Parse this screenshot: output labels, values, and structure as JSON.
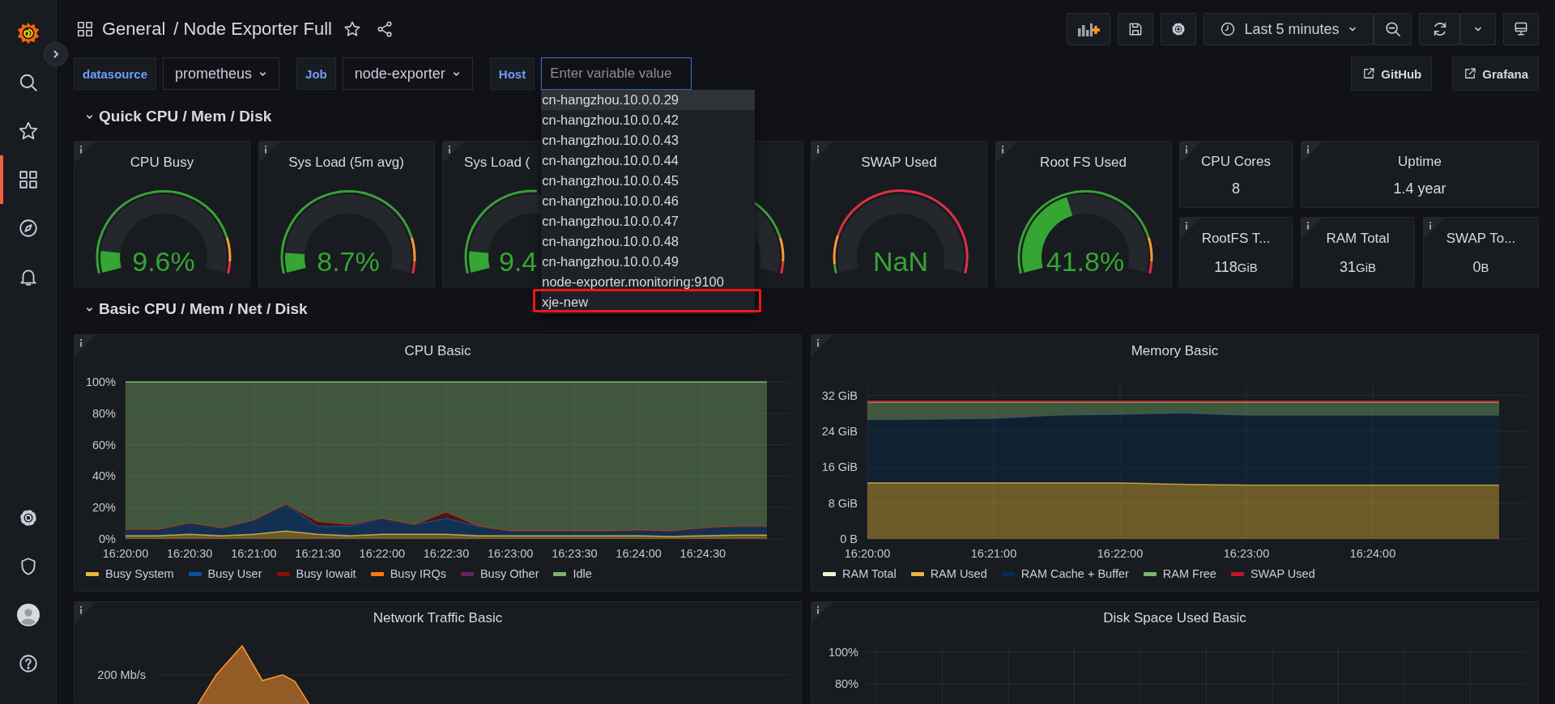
{
  "sidebar": {
    "items": [
      {
        "kind": "search",
        "selected": false
      },
      {
        "kind": "starred",
        "selected": false
      },
      {
        "kind": "dashboards",
        "selected": true
      },
      {
        "kind": "explore",
        "selected": false
      },
      {
        "kind": "alerting",
        "selected": false
      }
    ],
    "bottom_items": [
      {
        "kind": "settings",
        "selected": false
      },
      {
        "kind": "shield",
        "selected": false
      },
      {
        "kind": "profile",
        "selected": false
      },
      {
        "kind": "help",
        "selected": false
      }
    ]
  },
  "breadcrumb": {
    "folder": "General",
    "dashboard": "/ Node Exporter Full"
  },
  "toolbar": {
    "time_range": "Last 5 minutes"
  },
  "variables": [
    {
      "label": "datasource",
      "kind": "select",
      "value": "prometheus"
    },
    {
      "label": "Job",
      "kind": "select",
      "value": "node-exporter"
    },
    {
      "label": "Host",
      "kind": "text",
      "placeholder": "Enter variable value"
    }
  ],
  "links": [
    "GitHub",
    "Grafana"
  ],
  "host_options": [
    {
      "label": "cn-hangzhou.10.0.0.29",
      "selected": true,
      "annotated": false
    },
    {
      "label": "cn-hangzhou.10.0.0.42",
      "selected": false,
      "annotated": false
    },
    {
      "label": "cn-hangzhou.10.0.0.43",
      "selected": false,
      "annotated": false
    },
    {
      "label": "cn-hangzhou.10.0.0.44",
      "selected": false,
      "annotated": false
    },
    {
      "label": "cn-hangzhou.10.0.0.45",
      "selected": false,
      "annotated": false
    },
    {
      "label": "cn-hangzhou.10.0.0.46",
      "selected": false,
      "annotated": false
    },
    {
      "label": "cn-hangzhou.10.0.0.47",
      "selected": false,
      "annotated": false
    },
    {
      "label": "cn-hangzhou.10.0.0.48",
      "selected": false,
      "annotated": false
    },
    {
      "label": "cn-hangzhou.10.0.0.49",
      "selected": false,
      "annotated": false
    },
    {
      "label": "node-exporter.monitoring:9100",
      "selected": false,
      "annotated": false
    },
    {
      "label": "xje-new",
      "selected": false,
      "annotated": true
    }
  ],
  "rows": [
    {
      "title": "Quick CPU / Mem / Disk",
      "expanded": true
    },
    {
      "title": "Basic CPU / Mem / Net / Disk",
      "expanded": true
    }
  ],
  "gauges": [
    {
      "kind": "load",
      "title": "CPU Busy",
      "value": "9.6%",
      "level": 0.096,
      "cut_off": false
    },
    {
      "kind": "load",
      "title": "Sys Load (5m avg)",
      "value": "8.7%",
      "level": 0.087,
      "cut_off": false
    },
    {
      "kind": "load",
      "title": "Sys Load (",
      "value": "9.4",
      "level": 0.094,
      "cut_off": true
    },
    {
      "kind": "load"
    },
    {
      "kind": "swap",
      "title": "SWAP Used",
      "value": "NaN",
      "cut_off": false
    },
    {
      "kind": "load",
      "title": "Root FS Used",
      "value": "41.8%",
      "level": 0.418,
      "cut_off": false
    }
  ],
  "stats": [
    {
      "title": "CPU Cores",
      "value": "8"
    },
    {
      "title": "Uptime",
      "value": "1.4 year"
    },
    {
      "title": "RootFS T...",
      "value": "118",
      "unit": "GiB"
    },
    {
      "title": "RAM Total",
      "value": "31",
      "unit": "GiB"
    },
    {
      "title": "SWAP To...",
      "value": "0",
      "unit": "B"
    }
  ],
  "graph_panels": [
    {
      "title": "CPU Basic",
      "chart_data": {
        "type": "area",
        "stacked": true,
        "grid": true,
        "categories": [
          "16:20:00",
          null,
          "16:20:30",
          null,
          "16:21:00",
          null,
          "16:21:30",
          null,
          "16:22:00",
          null,
          "16:22:30",
          null,
          "16:23:00",
          null,
          "16:23:30",
          null,
          "16:24:00",
          null,
          "16:24:30",
          null,
          null
        ],
        "ylim": [
          0,
          100
        ],
        "yticks": [
          {
            "value": 0,
            "label": "0%"
          },
          {
            "value": 20,
            "label": "20%"
          },
          {
            "value": 40,
            "label": "40%"
          },
          {
            "value": 60,
            "label": "60%"
          },
          {
            "value": 80,
            "label": "80%"
          },
          {
            "value": 100,
            "label": "100%"
          }
        ],
        "series": [
          {
            "name": "Busy System",
            "color": "#eab839",
            "values": [
              2,
              2,
              3,
              2,
              3,
              5,
              3,
              2,
              3,
              3,
              3,
              2,
              2,
              2,
              2,
              2,
              2,
              1.5,
              2,
              2.5,
              2.5
            ]
          },
          {
            "name": "Busy User",
            "color": "#0a50a1",
            "values": [
              4,
              4,
              7,
              5,
              9,
              17,
              5,
              6,
              10,
              6,
              10,
              6,
              3,
              3,
              3,
              3,
              3.5,
              3.5,
              5,
              5.5,
              5.5
            ]
          },
          {
            "name": "Busy Iowait",
            "color": "#890f02",
            "values": [
              0,
              0,
              0,
              0,
              0,
              0,
              3,
              1,
              0,
              0,
              4,
              0,
              0,
              0,
              0,
              0,
              0,
              0,
              0,
              0,
              0
            ]
          },
          {
            "name": "Busy IRQs",
            "color": "#ff780a",
            "values": [
              null,
              null,
              null,
              null,
              null,
              null,
              null,
              null,
              null,
              null,
              null,
              null,
              null,
              null,
              null,
              null,
              null,
              null,
              null,
              null,
              null
            ]
          },
          {
            "name": "Busy Other",
            "color": "#6d1f62",
            "values": [
              null,
              null,
              null,
              null,
              null,
              null,
              null,
              null,
              null,
              null,
              null,
              null,
              null,
              null,
              null,
              null,
              null,
              null,
              null,
              null,
              null
            ]
          },
          {
            "name": "Idle",
            "color": "#7eb26d",
            "values": [
              94,
              94,
              90,
              93,
              88,
              78,
              89,
              91,
              87,
              91,
              83,
              92,
              95,
              95,
              95,
              95,
              94.5,
              95,
              93,
              92,
              92
            ]
          }
        ]
      }
    },
    {
      "title": "Memory Basic",
      "chart_data": {
        "type": "area",
        "stacked": true,
        "grid": true,
        "categories": [
          "16:20:00",
          null,
          "16:21:00",
          null,
          "16:22:00",
          null,
          "16:23:00",
          null,
          "16:24:00",
          null,
          null
        ],
        "ylim": [
          0,
          35
        ],
        "yticks": [
          {
            "value": 0,
            "label": "0 B"
          },
          {
            "value": 8,
            "label": "8 GiB"
          },
          {
            "value": 16,
            "label": "16 GiB"
          },
          {
            "value": 24,
            "label": "24 GiB"
          },
          {
            "value": 32,
            "label": "32 GiB"
          }
        ],
        "series": [
          {
            "name": "RAM Total",
            "color": "#e0f9d7",
            "values": [
              null,
              null,
              null,
              null,
              null,
              null,
              null,
              null,
              null,
              null,
              null
            ]
          },
          {
            "name": "RAM Used",
            "color": "#eab839",
            "values": [
              12.5,
              12.5,
              12.5,
              12.5,
              12.5,
              12.2,
              12,
              12,
              12,
              12,
              12
            ]
          },
          {
            "name": "RAM Cache + Buffer",
            "color": "#052b51",
            "values": [
              14,
              14.1,
              14.3,
              15,
              15.2,
              15.8,
              15.5,
              15.5,
              15.5,
              15.5,
              15.5
            ]
          },
          {
            "name": "RAM Free",
            "color": "#7eb26d",
            "values": [
              4,
              3.9,
              3.7,
              3,
              2.8,
              2.5,
              3,
              3,
              3,
              3,
              3
            ]
          },
          {
            "name": "SWAP Used",
            "color": "#c4162a",
            "values": [
              0.2,
              0.2,
              0.2,
              0.2,
              0.2,
              0.2,
              0.2,
              0.2,
              0.2,
              0.2,
              0.2
            ]
          }
        ]
      }
    }
  ],
  "lower_panels": [
    {
      "kind": "traffic",
      "title": "Network Traffic Basic",
      "y_tick_labels": [
        "200 Mb/s"
      ]
    },
    {
      "kind": "grid",
      "title": "Disk Space Used Basic",
      "y_tick_labels": [
        "100%",
        "80%"
      ]
    }
  ]
}
